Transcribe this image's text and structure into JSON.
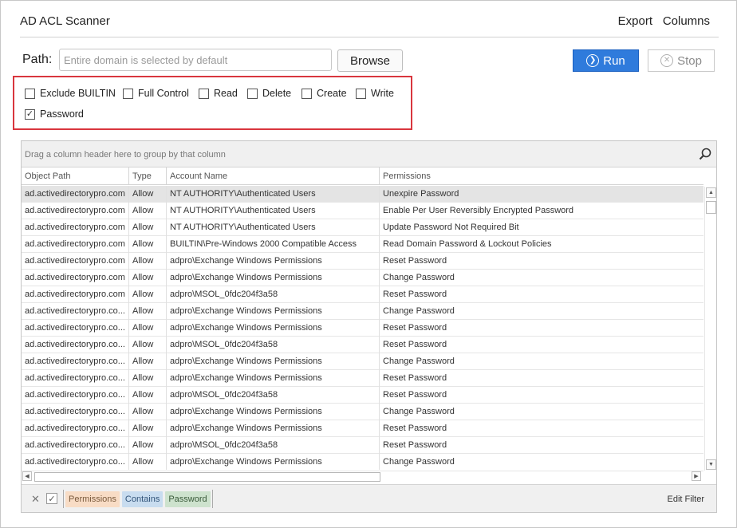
{
  "app": {
    "title": "AD ACL Scanner"
  },
  "menu": {
    "export": "Export",
    "columns": "Columns"
  },
  "path": {
    "label": "Path:",
    "value": "",
    "placeholder": "Entire domain is selected by default"
  },
  "buttons": {
    "browse": "Browse",
    "run": "Run",
    "stop": "Stop"
  },
  "filters": [
    {
      "label": "Exclude BUILTIN",
      "checked": false
    },
    {
      "label": "Full Control",
      "checked": false
    },
    {
      "label": "Read",
      "checked": false
    },
    {
      "label": "Delete",
      "checked": false
    },
    {
      "label": "Create",
      "checked": false
    },
    {
      "label": "Write",
      "checked": false
    },
    {
      "label": "Password",
      "checked": true
    }
  ],
  "grid": {
    "group_hint": "Drag a column header here to group by that column",
    "columns": [
      "Object Path",
      "Type",
      "Account Name",
      "Permissions"
    ],
    "rows": [
      [
        "ad.activedirectorypro.com",
        "Allow",
        "NT AUTHORITY\\Authenticated Users",
        "Unexpire Password"
      ],
      [
        "ad.activedirectorypro.com",
        "Allow",
        "NT AUTHORITY\\Authenticated Users",
        "Enable Per User Reversibly Encrypted Password"
      ],
      [
        "ad.activedirectorypro.com",
        "Allow",
        "NT AUTHORITY\\Authenticated Users",
        "Update Password Not Required Bit"
      ],
      [
        "ad.activedirectorypro.com",
        "Allow",
        "BUILTIN\\Pre-Windows 2000 Compatible Access",
        "Read Domain Password & Lockout Policies"
      ],
      [
        "ad.activedirectorypro.com",
        "Allow",
        "adpro\\Exchange Windows Permissions",
        "Reset Password"
      ],
      [
        "ad.activedirectorypro.com",
        "Allow",
        "adpro\\Exchange Windows Permissions",
        "Change Password"
      ],
      [
        "ad.activedirectorypro.com",
        "Allow",
        "adpro\\MSOL_0fdc204f3a58",
        "Reset Password"
      ],
      [
        "ad.activedirectorypro.co...",
        "Allow",
        "adpro\\Exchange Windows Permissions",
        "Change Password"
      ],
      [
        "ad.activedirectorypro.co...",
        "Allow",
        "adpro\\Exchange Windows Permissions",
        "Reset Password"
      ],
      [
        "ad.activedirectorypro.co...",
        "Allow",
        "adpro\\MSOL_0fdc204f3a58",
        "Reset Password"
      ],
      [
        "ad.activedirectorypro.co...",
        "Allow",
        "adpro\\Exchange Windows Permissions",
        "Change Password"
      ],
      [
        "ad.activedirectorypro.co...",
        "Allow",
        "adpro\\Exchange Windows Permissions",
        "Reset Password"
      ],
      [
        "ad.activedirectorypro.co...",
        "Allow",
        "adpro\\MSOL_0fdc204f3a58",
        "Reset Password"
      ],
      [
        "ad.activedirectorypro.co...",
        "Allow",
        "adpro\\Exchange Windows Permissions",
        "Change Password"
      ],
      [
        "ad.activedirectorypro.co...",
        "Allow",
        "adpro\\Exchange Windows Permissions",
        "Reset Password"
      ],
      [
        "ad.activedirectorypro.co...",
        "Allow",
        "adpro\\MSOL_0fdc204f3a58",
        "Reset Password"
      ],
      [
        "ad.activedirectorypro.co...",
        "Allow",
        "adpro\\Exchange Windows Permissions",
        "Change Password"
      ]
    ]
  },
  "filter_panel": {
    "field": "Permissions",
    "operator": "Contains",
    "value": "Password",
    "edit_label": "Edit Filter"
  },
  "icons": {
    "search": "search-icon",
    "run": "play-circle-icon",
    "stop": "close-circle-icon"
  },
  "colors": {
    "run_button": "#2f7bdc",
    "highlight_box": "#d9363e"
  }
}
